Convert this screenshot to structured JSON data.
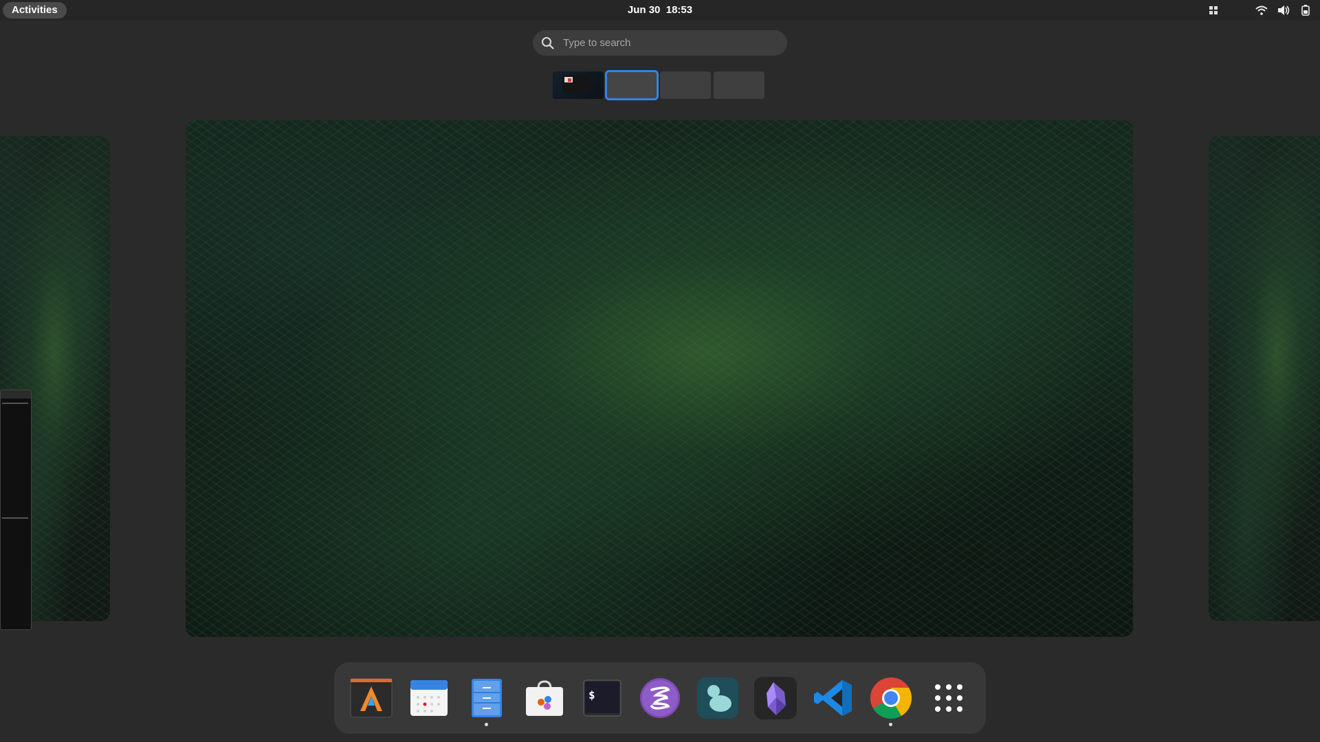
{
  "topbar": {
    "activities_label": "Activities",
    "date": "Jun 30",
    "time": "18:53",
    "tray_icons": [
      "apps-grid-icon",
      "wifi-icon",
      "volume-icon",
      "battery-icon"
    ]
  },
  "search": {
    "placeholder": "Type to search"
  },
  "workspaces": {
    "count": 4,
    "active_index": 1
  },
  "dock": {
    "apps": [
      {
        "icon": "alacritty-icon",
        "running": false
      },
      {
        "icon": "calendar-icon",
        "running": false
      },
      {
        "icon": "files-icon",
        "running": true
      },
      {
        "icon": "software-store-icon",
        "running": false
      },
      {
        "icon": "terminal-icon",
        "running": false
      },
      {
        "icon": "emacs-icon",
        "running": false
      },
      {
        "icon": "blob-app-icon",
        "running": false
      },
      {
        "icon": "obsidian-icon",
        "running": false
      },
      {
        "icon": "vscode-icon",
        "running": false
      },
      {
        "icon": "chrome-icon",
        "running": true
      },
      {
        "icon": "show-apps-icon",
        "running": false
      }
    ],
    "terminal_glyph": "$"
  },
  "colors": {
    "accent": "#3584e4",
    "panel": "#262626",
    "dock": "#383838",
    "search": "#3d3d3d"
  }
}
